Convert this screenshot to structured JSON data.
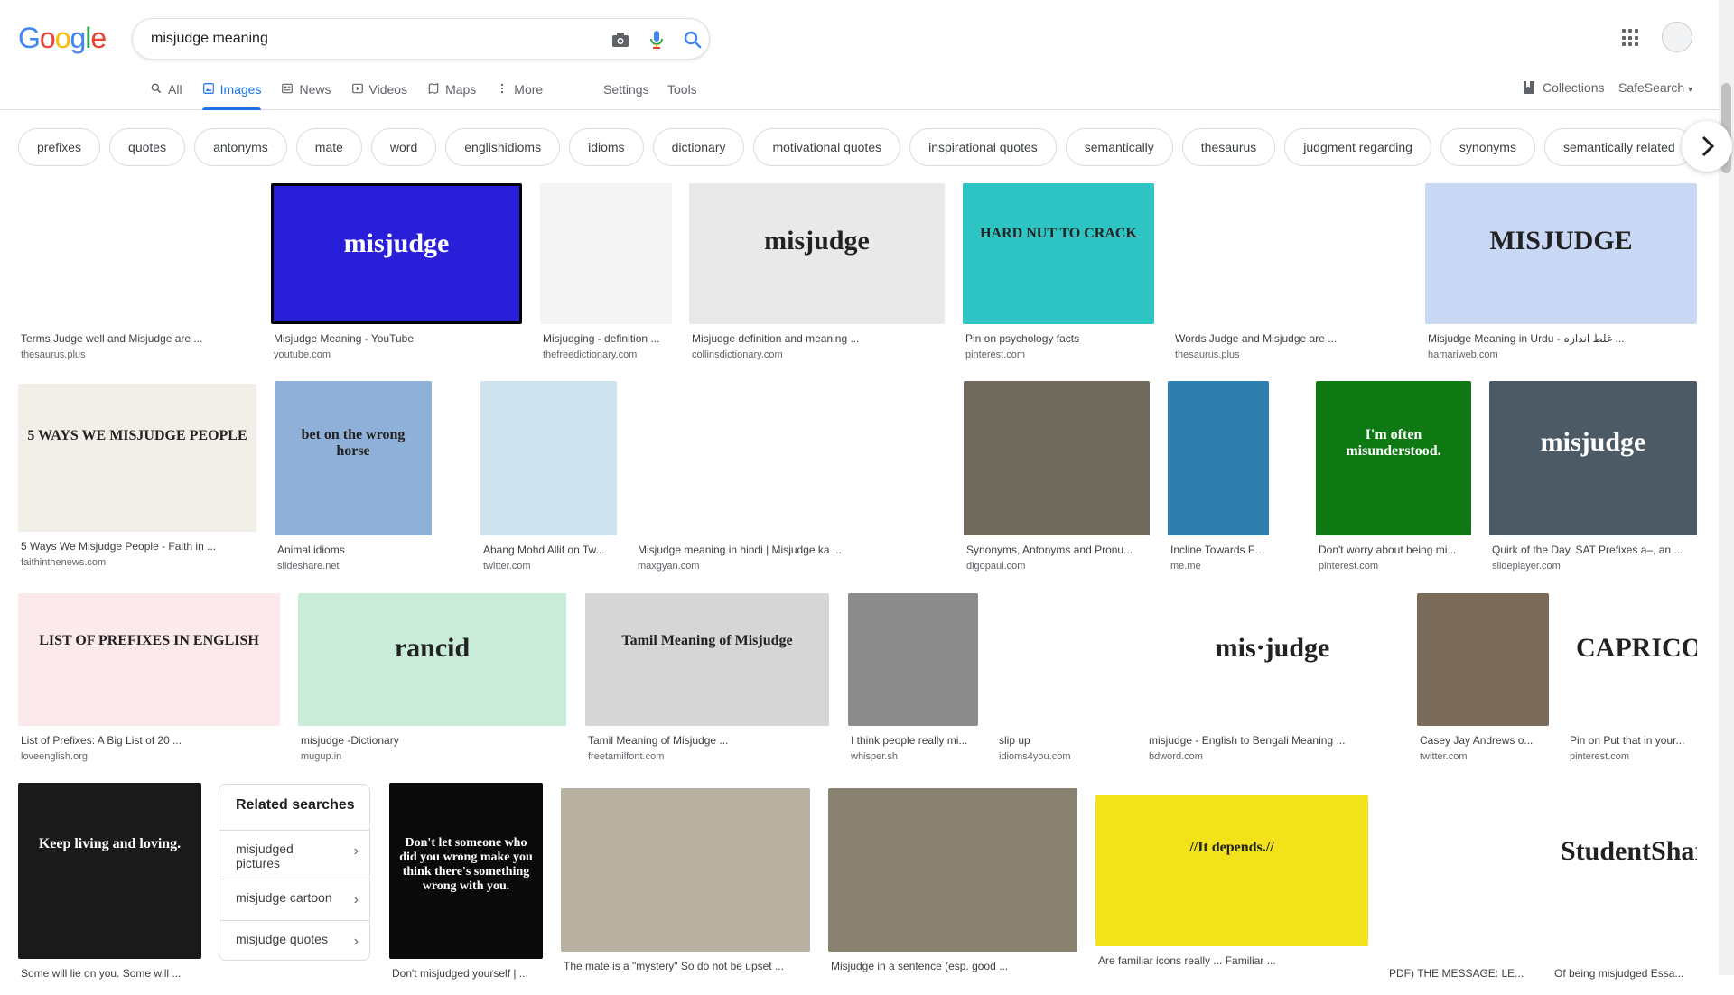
{
  "search": {
    "query": "misjudge meaning"
  },
  "logo": {
    "letters": [
      "G",
      "o",
      "o",
      "g",
      "l",
      "e"
    ],
    "colors": [
      "#4285F4",
      "#EA4335",
      "#FBBC05",
      "#4285F4",
      "#34A853",
      "#EA4335"
    ]
  },
  "tabs": [
    {
      "label": "All",
      "icon": "search-icon"
    },
    {
      "label": "Images",
      "icon": "image-icon",
      "active": true
    },
    {
      "label": "News",
      "icon": "news-icon"
    },
    {
      "label": "Videos",
      "icon": "video-icon"
    },
    {
      "label": "Maps",
      "icon": "map-icon"
    },
    {
      "label": "More",
      "icon": "more-vert-icon"
    }
  ],
  "tools": {
    "settings": "Settings",
    "tools": "Tools",
    "collections": "Collections",
    "safesearch": "SafeSearch"
  },
  "chips": [
    "prefixes",
    "quotes",
    "antonyms",
    "mate",
    "word",
    "englishidioms",
    "idioms",
    "dictionary",
    "motivational quotes",
    "inspirational quotes",
    "semantically",
    "thesaurus",
    "judgment regarding",
    "synonyms",
    "semantically related"
  ],
  "results": [
    {
      "title": "Terms Judge well and Misjudge are ...",
      "source": "thesaurus.plus",
      "bg": "#ffffff"
    },
    {
      "title": "Misjudge Meaning - YouTube",
      "source": "youtube.com",
      "bg": "#2a1fd9",
      "caption": "misjudge"
    },
    {
      "title": "Misjudging - definition ...",
      "source": "thefreedictionary.com",
      "bg": "#f4f4f4"
    },
    {
      "title": "Misjudge definition and meaning ...",
      "source": "collinsdictionary.com",
      "bg": "#e9e9e9",
      "caption": "misjudge"
    },
    {
      "title": "Pin on psychology facts",
      "source": "pinterest.com",
      "bg": "#2ec4c4",
      "caption": "HARD NUT TO CRACK"
    },
    {
      "title": "Words Judge and Misjudge are ...",
      "source": "thesaurus.plus",
      "bg": "#ffffff"
    },
    {
      "title": "Misjudge Meaning in Urdu - غلط اندازہ ...",
      "source": "hamariweb.com",
      "bg": "#c8d8f5",
      "caption": "MISJUDGE"
    },
    {
      "title": "5 Ways We Misjudge People - Faith in ...",
      "source": "faithinthenews.com",
      "bg": "#f2efe9",
      "caption": "5 WAYS WE MISJUDGE PEOPLE"
    },
    {
      "title": "Animal idioms",
      "source": "slideshare.net",
      "bg": "#8fb0d8",
      "caption": "bet on the wrong horse"
    },
    {
      "title": "Abang Mohd Allif on Tw...",
      "source": "twitter.com",
      "bg": "#cfe3ef"
    },
    {
      "title": "Misjudge meaning in hindi | Misjudge ka ...",
      "source": "maxgyan.com",
      "bg": "#ffffff"
    },
    {
      "title": "Synonyms, Antonyms and Pronu...",
      "source": "digopaul.com",
      "bg": "#6f6a5c"
    },
    {
      "title": "Incline Towards Feelin...",
      "source": "me.me",
      "bg": "#2e7fb0"
    },
    {
      "title": "Don't worry about being mi...",
      "source": "pinterest.com",
      "bg": "#0f7a14",
      "caption": "I'm often misunderstood."
    },
    {
      "title": "Quirk of the Day. SAT Prefixes a–, an ...",
      "source": "slideplayer.com",
      "bg": "#4c5a66",
      "caption": "misjudge"
    },
    {
      "title": "List of Prefixes: A Big List of 20 ...",
      "source": "loveenglish.org",
      "bg": "#fbe9ec",
      "caption": "LIST OF PREFIXES IN ENGLISH"
    },
    {
      "title": "misjudge -Dictionary",
      "source": "mugup.in",
      "bg": "#c9ecd9",
      "caption": "rancid"
    },
    {
      "title": "Tamil Meaning of Misjudge ...",
      "source": "freetamilfont.com",
      "bg": "#d6d6d6",
      "caption": "Tamil Meaning of Misjudge"
    },
    {
      "title": "I think people really mi...",
      "source": "whisper.sh",
      "bg": "#8c8c8c"
    },
    {
      "title": "slip up",
      "source": "idioms4you.com",
      "bg": "#ffffff"
    },
    {
      "title": "misjudge - English to Bengali Meaning ...",
      "source": "bdword.com",
      "bg": "#ffffff",
      "caption": "mis·judge"
    },
    {
      "title": "Casey Jay Andrews o...",
      "source": "twitter.com",
      "bg": "#7a6a5a"
    },
    {
      "title": "Pin on Put that in your...",
      "source": "pinterest.com",
      "bg": "#ffffff",
      "caption": "CAPRICORN"
    },
    {
      "title": "Some will lie on you. Some will ...",
      "source": "",
      "bg": "#1a1a1a",
      "caption": "Keep living and loving."
    },
    {
      "title": "Don't misjudged yourself | ...",
      "source": "",
      "bg": "#0a0a0a",
      "caption": "Don't let someone who did you wrong make you think there's something wrong with you."
    },
    {
      "title": "The mate is a \"mystery\" So do not be upset ...",
      "source": "",
      "bg": "#b8b0a0"
    },
    {
      "title": "Misjudge in a sentence (esp. good ...",
      "source": "",
      "bg": "#8a8270"
    },
    {
      "title": "Are familiar icons really ... Familiar ...",
      "source": "",
      "bg": "#f2e21a",
      "caption": "//It depends.//"
    },
    {
      "title": "PDF) THE MESSAGE: LE...",
      "source": "",
      "bg": "#ffffff"
    },
    {
      "title": "Of being misjudged Essa...",
      "source": "",
      "bg": "#ffffff",
      "caption": "StudentShare"
    }
  ],
  "related": {
    "heading": "Related searches",
    "items": [
      "misjudged pictures",
      "misjudge cartoon",
      "misjudge quotes"
    ]
  }
}
